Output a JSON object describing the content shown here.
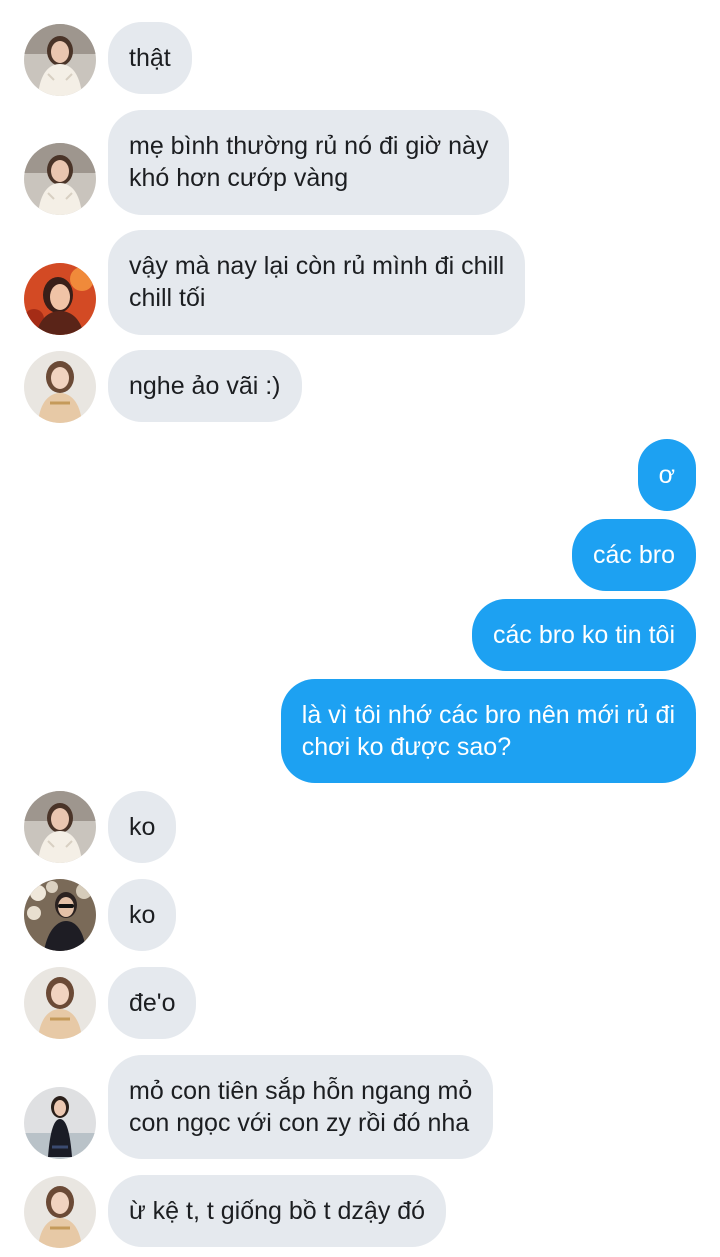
{
  "conversation": {
    "messages": [
      {
        "direction": "incoming",
        "sender": "avatar-girl-white-sweater",
        "text_lines": [
          "thật"
        ]
      },
      {
        "direction": "incoming",
        "sender": "avatar-girl-white-sweater",
        "text_lines": [
          "mẹ bình thường rủ nó đi giờ này",
          "khó hơn cướp vàng"
        ]
      },
      {
        "direction": "incoming",
        "sender": "avatar-girl-red-background",
        "text_lines": [
          "vậy mà nay lại còn rủ mình đi chill",
          "chill tối"
        ]
      },
      {
        "direction": "incoming",
        "sender": "avatar-girl-gold-dress",
        "text_lines": [
          "nghe ảo vãi :)"
        ]
      },
      {
        "direction": "outgoing",
        "text_lines": [
          "ơ"
        ]
      },
      {
        "direction": "outgoing",
        "text_lines": [
          "các bro"
        ]
      },
      {
        "direction": "outgoing",
        "text_lines": [
          "các bro ko tin tôi"
        ]
      },
      {
        "direction": "outgoing",
        "text_lines": [
          "là vì tôi nhớ các bro nên mới rủ đi",
          "chơi ko được sao?"
        ]
      },
      {
        "direction": "incoming",
        "sender": "avatar-girl-white-sweater",
        "text_lines": [
          "ko"
        ]
      },
      {
        "direction": "incoming",
        "sender": "avatar-girl-sunglasses-flowers",
        "text_lines": [
          "ko"
        ]
      },
      {
        "direction": "incoming",
        "sender": "avatar-girl-gold-dress",
        "text_lines": [
          "đe'o"
        ]
      },
      {
        "direction": "incoming",
        "sender": "avatar-girl-black-dress",
        "text_lines": [
          "mỏ con tiên sắp hỗn ngang mỏ",
          "con ngọc với con zy rồi đó nha"
        ]
      },
      {
        "direction": "incoming",
        "sender": "avatar-girl-gold-dress",
        "text_lines": [
          "ừ kệ t, t giống bồ t dzậy đó"
        ]
      }
    ]
  },
  "colors": {
    "incoming_bubble": "#e5e9ee",
    "outgoing_bubble": "#1da1f2",
    "incoming_text": "#1c1e21",
    "outgoing_text": "#ffffff"
  }
}
